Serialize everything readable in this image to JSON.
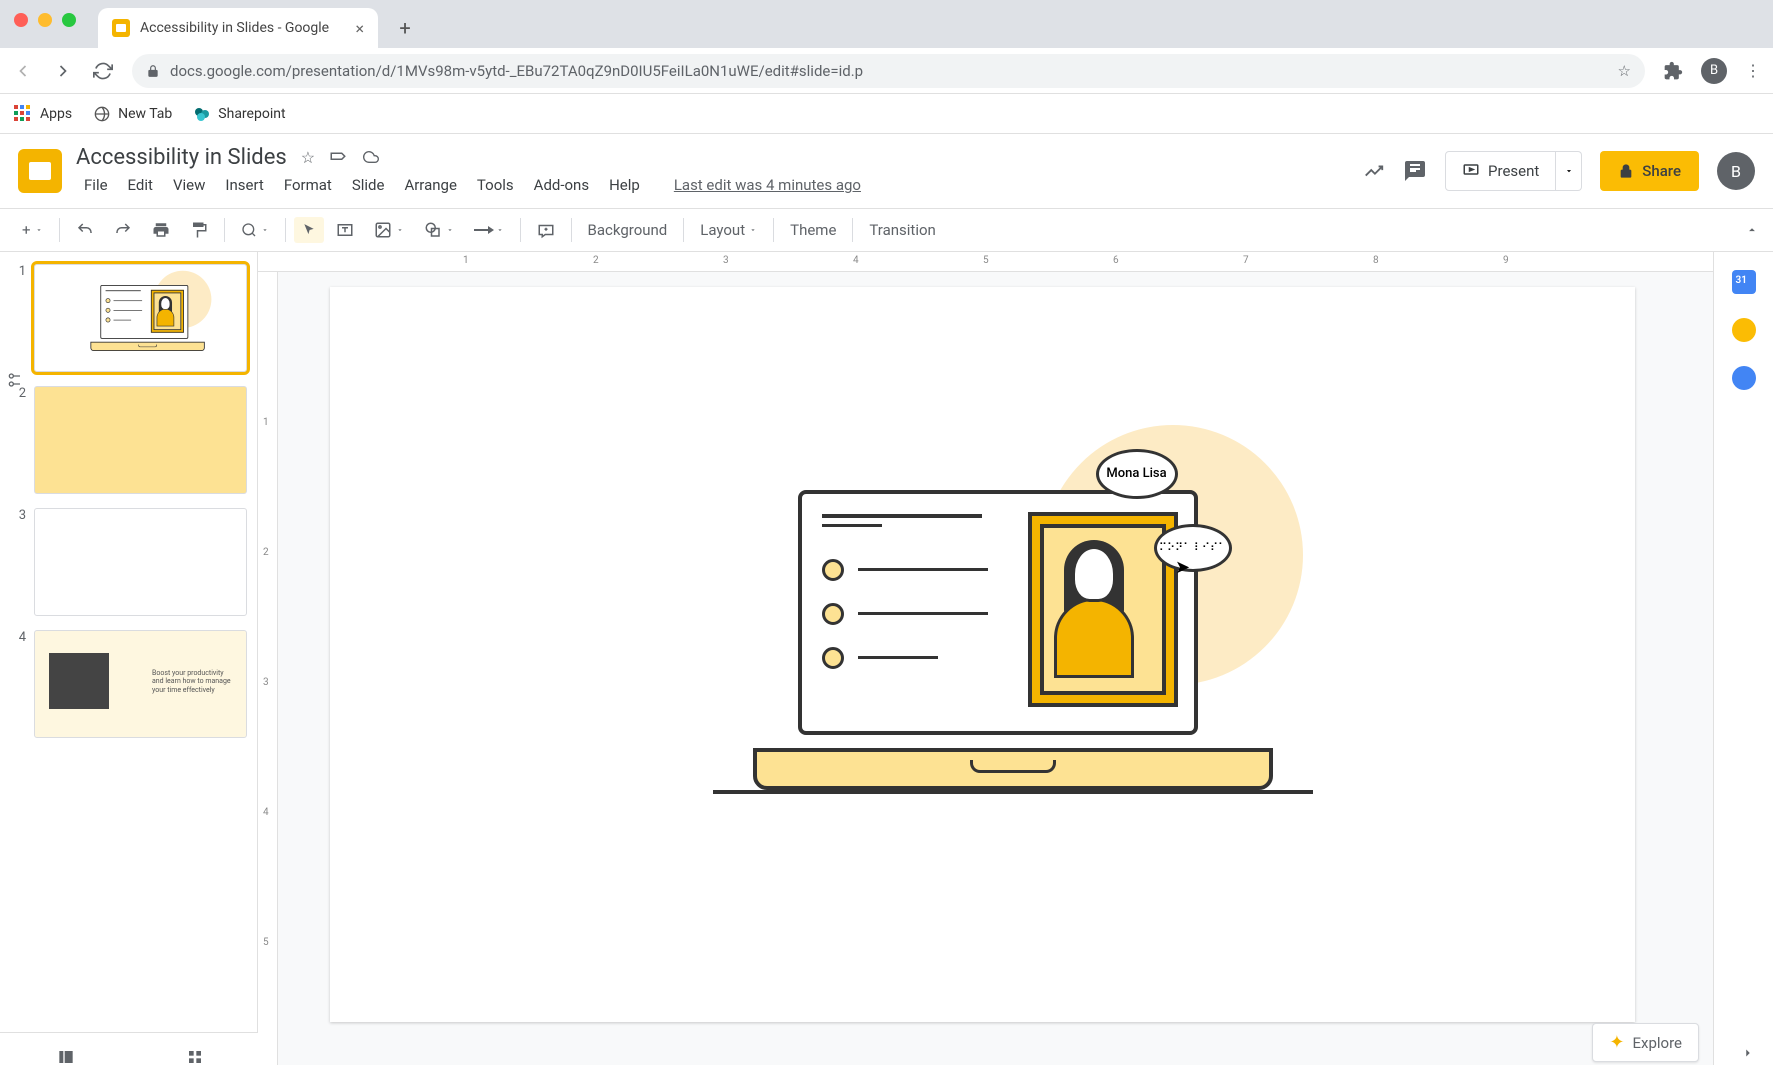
{
  "browser": {
    "tab_title": "Accessibility in Slides - Google",
    "url": "docs.google.com/presentation/d/1MVs98m-v5ytd-_EBu72TA0qZ9nD0IU5FeiILa0N1uWE/edit#slide=id.p",
    "bookmarks": {
      "apps": "Apps",
      "newtab": "New Tab",
      "sharepoint": "Sharepoint"
    },
    "avatar_letter": "B"
  },
  "doc": {
    "title": "Accessibility in Slides",
    "last_edit": "Last edit was 4 minutes ago",
    "menus": [
      "File",
      "Edit",
      "View",
      "Insert",
      "Format",
      "Slide",
      "Arrange",
      "Tools",
      "Add-ons",
      "Help"
    ],
    "present_label": "Present",
    "share_label": "Share",
    "avatar_letter": "B"
  },
  "toolbar": {
    "background": "Background",
    "layout": "Layout",
    "theme": "Theme",
    "transition": "Transition"
  },
  "slides": [
    {
      "num": "1"
    },
    {
      "num": "2"
    },
    {
      "num": "3"
    },
    {
      "num": "4",
      "thumb_text": "Boost your productivity and learn how to manage your time effectively"
    }
  ],
  "ruler_marks": [
    "1",
    "2",
    "3",
    "4",
    "5",
    "6",
    "7",
    "8",
    "9"
  ],
  "ruler_v_marks": [
    "1",
    "2",
    "3",
    "4",
    "5"
  ],
  "canvas": {
    "bubble1": "Mona Lisa",
    "bubble2": "⠍⠕⠝⠁ ⠇⠊⠎⠁"
  },
  "explore": "Explore"
}
